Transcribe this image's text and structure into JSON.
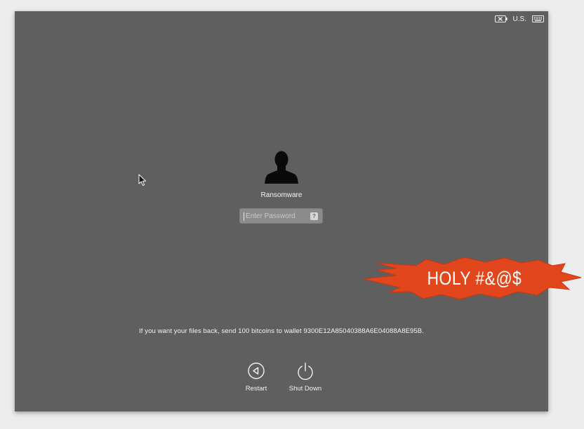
{
  "menubar": {
    "input_source": "U.S.",
    "icons": [
      "battery-x-icon",
      "keyboard-icon"
    ]
  },
  "login": {
    "username": "Ransomware",
    "password_placeholder": "Enter Password",
    "help_label": "?"
  },
  "message": "If you want your files back, send 100 bitcoins to wallet 9300E12A85040388A6E04088A8E95B.",
  "buttons": {
    "restart_label": "Restart",
    "shutdown_label": "Shut Down"
  },
  "overlay": {
    "text": "HOLY #&@$",
    "color": "#e2461c"
  },
  "colors": {
    "screen_bg": "#5f5f5f",
    "outer_bg": "#ececec"
  }
}
